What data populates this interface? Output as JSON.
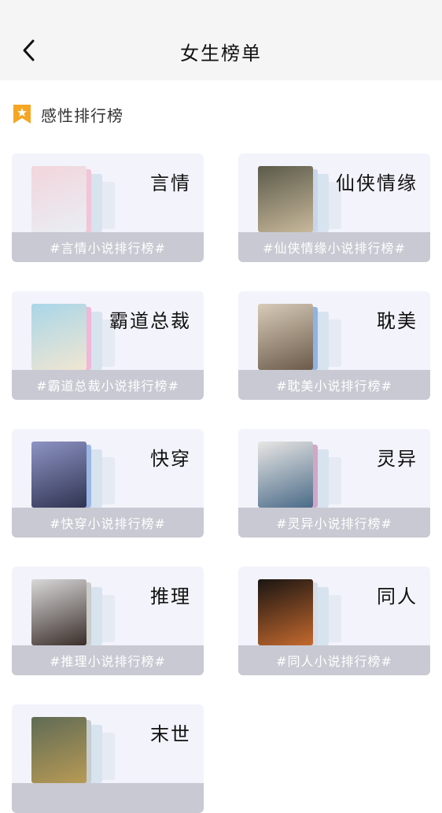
{
  "header": {
    "title": "女生榜单"
  },
  "section": {
    "title": "感性排行榜"
  },
  "colors": {
    "accent": "#f5a623",
    "card_bg": "#f3f3fb",
    "footer_bg": "#c9c9d3"
  },
  "categories": [
    {
      "name": "言情",
      "tag": "#言情小说排行榜#",
      "cover": [
        "#f2d5dc",
        "#e9eef4"
      ],
      "spine": "#f2c4d6"
    },
    {
      "name": "仙侠情缘",
      "tag": "#仙侠情缘小说排行榜#",
      "cover": [
        "#5b5a4a",
        "#c8b89a"
      ],
      "spine": "#c9d6e9"
    },
    {
      "name": "霸道总裁",
      "tag": "#霸道总裁小说排行榜#",
      "cover": [
        "#a9d6e8",
        "#f0e6d2"
      ],
      "spine": "#f0b7d8"
    },
    {
      "name": "耽美",
      "tag": "#耽美小说排行榜#",
      "cover": [
        "#d8cbb8",
        "#6b5a4a"
      ],
      "spine": "#8fb4e0"
    },
    {
      "name": "快穿",
      "tag": "#快穿小说排行榜#",
      "cover": [
        "#8e94c4",
        "#2f3452"
      ],
      "spine": "#9bb7e6"
    },
    {
      "name": "灵异",
      "tag": "#灵异小说排行榜#",
      "cover": [
        "#e8e6e4",
        "#4a6b88"
      ],
      "spine": "#d1a6c7"
    },
    {
      "name": "推理",
      "tag": "#推理小说排行榜#",
      "cover": [
        "#d9d9d9",
        "#3a2e2a"
      ],
      "spine": "#c9ccc8"
    },
    {
      "name": "同人",
      "tag": "#同人小说排行榜#",
      "cover": [
        "#1a1512",
        "#c4692e"
      ],
      "spine": "#d7dde6"
    },
    {
      "name": "末世",
      "tag": "",
      "cover": [
        "#5f6b55",
        "#b89a55"
      ],
      "spine": "#c7ccd0"
    }
  ]
}
